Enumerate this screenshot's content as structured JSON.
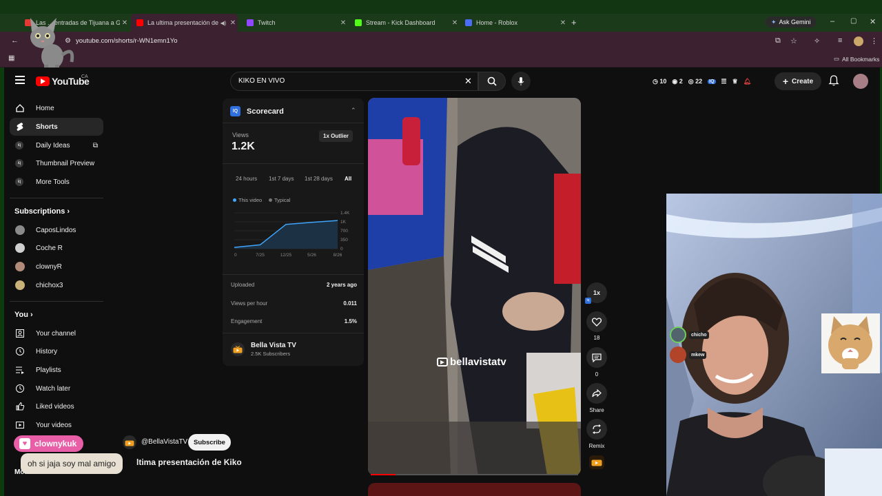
{
  "browser": {
    "tabs": [
      {
        "label": "Las ... entradas de Tijuana a G...",
        "color": "#e53935"
      },
      {
        "label": "La ultima presentación de K",
        "color": "#ff0000",
        "active": true
      },
      {
        "label": "Twitch",
        "color": "#9146ff"
      },
      {
        "label": "Stream - Kick Dashboard",
        "color": "#53fc18"
      },
      {
        "label": "Home - Roblox",
        "color": "#4a6cf7"
      }
    ],
    "ask_gemini": "Ask Gemini",
    "url": "youtube.com/shorts/r-WN1emn1Yo",
    "all_bookmarks": "All Bookmarks"
  },
  "masthead": {
    "logo_text": "YouTube",
    "country": "CA",
    "search_value": "KIKO EN VIVO",
    "stats": {
      "a": "10",
      "b": "2",
      "c": "22"
    },
    "create_label": "Create"
  },
  "sidebar": {
    "main": [
      {
        "label": "Home",
        "icon": "home-icon"
      },
      {
        "label": "Shorts",
        "icon": "shorts-icon",
        "active": true
      },
      {
        "label": "Daily Ideas",
        "icon": "vidiq-icon"
      },
      {
        "label": "Thumbnail Preview",
        "icon": "vidiq-icon"
      },
      {
        "label": "More Tools",
        "icon": "vidiq-icon"
      }
    ],
    "subscriptions_title": "Subscriptions",
    "subscriptions": [
      {
        "label": "CaposLindos",
        "color": "#8a8a8a"
      },
      {
        "label": "Coche R",
        "color": "#cfcfcf"
      },
      {
        "label": "clownyR",
        "color": "#b08b7a"
      },
      {
        "label": "chichox3",
        "color": "#c9b27a"
      }
    ],
    "you_title": "You",
    "you": [
      {
        "label": "Your channel",
        "icon": "channel-icon"
      },
      {
        "label": "History",
        "icon": "history-icon"
      },
      {
        "label": "Playlists",
        "icon": "playlists-icon"
      },
      {
        "label": "Watch later",
        "icon": "watch-later-icon"
      },
      {
        "label": "Liked videos",
        "icon": "liked-icon"
      },
      {
        "label": "Your videos",
        "icon": "your-videos-icon"
      }
    ],
    "more_title": "More"
  },
  "scorecard": {
    "title": "Scorecard",
    "views_label": "Views",
    "views_value": "1.2K",
    "outlier": "1x Outlier",
    "ranges": [
      "24 hours",
      "1st 7 days",
      "1st 28 days",
      "All"
    ],
    "legend_this": "This video",
    "legend_typical": "Typical",
    "rows": [
      {
        "label": "Uploaded",
        "value": "2 years ago"
      },
      {
        "label": "Views per hour",
        "value": "0.011"
      },
      {
        "label": "Engagement",
        "value": "1.5%"
      }
    ],
    "channel_name": "Bella Vista TV",
    "channel_subs": "2.5K Subscribers"
  },
  "chart_data": {
    "type": "line",
    "x": [
      "0",
      "7/25",
      "12/25",
      "5/26",
      "8/26"
    ],
    "series": [
      {
        "name": "This video",
        "values": [
          50,
          150,
          950,
          1030,
          1100
        ]
      }
    ],
    "yticks": [
      "1.4K",
      "1K",
      "700",
      "350",
      "0"
    ],
    "ylim": [
      0,
      1400
    ]
  },
  "player": {
    "watermark": "bellavistatv",
    "speed": "1x",
    "likes": "18",
    "comments": "0",
    "share": "Share",
    "remix": "Remix",
    "progress": 0.12
  },
  "below": {
    "handle": "@BellaVistaTV",
    "subscribe": "Subscribe",
    "title": "ltima presentación de Kiko"
  },
  "chat": {
    "user": "clownykuk",
    "message": "oh si jaja soy mal amigo"
  },
  "webcam": {
    "viewers": [
      {
        "name": "chicho"
      },
      {
        "name": "mkew"
      }
    ]
  }
}
